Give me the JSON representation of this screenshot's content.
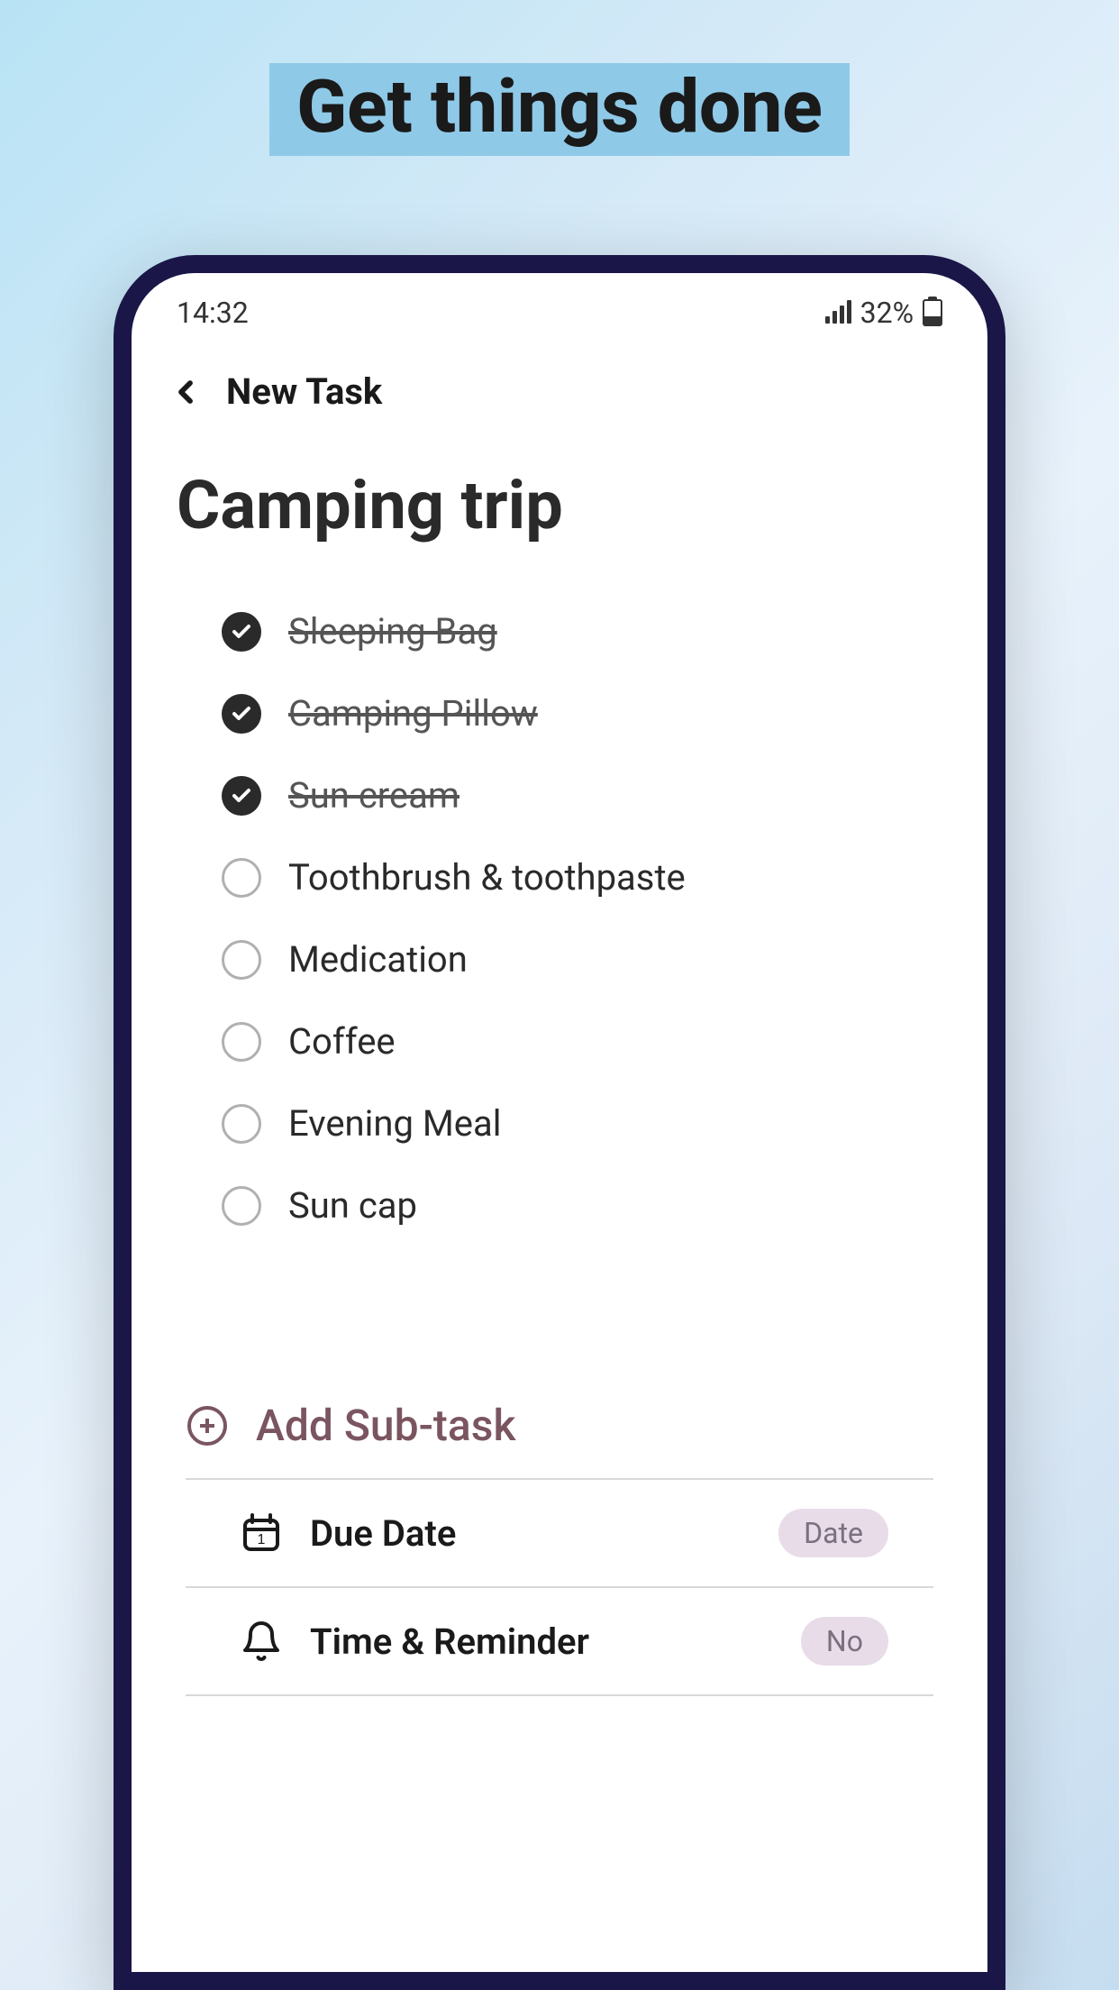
{
  "headline": "Get things done",
  "statusBar": {
    "time": "14:32",
    "battery": "32%"
  },
  "nav": {
    "title": "New Task"
  },
  "task": {
    "title": "Camping trip"
  },
  "subtasks": [
    {
      "label": "Sleeping Bag",
      "done": true
    },
    {
      "label": "Camping Pillow",
      "done": true
    },
    {
      "label": "Sun cream",
      "done": true
    },
    {
      "label": "Toothbrush & toothpaste",
      "done": false
    },
    {
      "label": "Medication",
      "done": false
    },
    {
      "label": "Coffee",
      "done": false
    },
    {
      "label": "Evening Meal",
      "done": false
    },
    {
      "label": "Sun cap",
      "done": false
    }
  ],
  "addSubtask": {
    "label": "Add Sub-task"
  },
  "options": {
    "dueDate": {
      "label": "Due Date",
      "value": "Date"
    },
    "reminder": {
      "label": "Time & Reminder",
      "value": "No"
    }
  },
  "colors": {
    "accent": "#7a5560",
    "checkDark": "#2a2a2a"
  }
}
